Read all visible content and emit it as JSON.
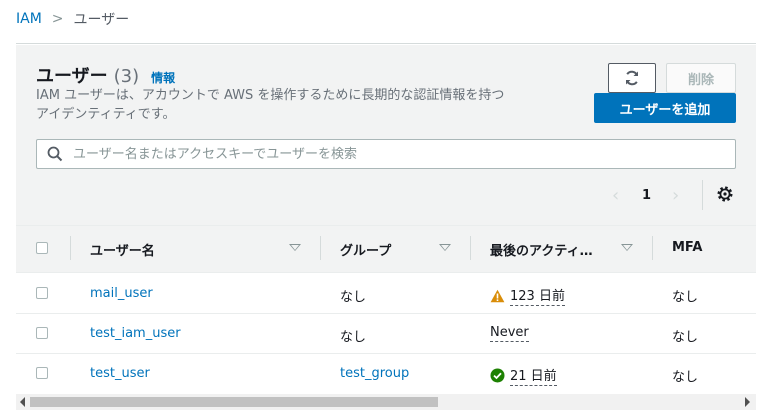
{
  "breadcrumb": {
    "root": "IAM",
    "separator": ">",
    "current": "ユーザー"
  },
  "header": {
    "title": "ユーザー",
    "count": "(3)",
    "info": "情報",
    "description": "IAM ユーザーは、アカウントで AWS を操作するために長期的な認証情報を持つアイデンティティです。",
    "refresh_icon": "refresh-icon",
    "delete_label": "削除",
    "add_label": "ユーザーを追加"
  },
  "search": {
    "placeholder": "ユーザー名またはアクセスキーでユーザーを検索",
    "value": ""
  },
  "pagination": {
    "page": "1",
    "prev": "‹",
    "next": "›"
  },
  "table": {
    "columns": [
      "ユーザー名",
      "グループ",
      "最後のアクティ…",
      "MFA"
    ],
    "rows": [
      {
        "user": "mail_user",
        "group": "なし",
        "activity": "123 日前",
        "activity_status": "warning",
        "mfa": "なし"
      },
      {
        "user": "test_iam_user",
        "group": "なし",
        "activity": "Never",
        "activity_status": "none",
        "mfa": "なし"
      },
      {
        "user": "test_user",
        "group": "test_group",
        "activity": "21 日前",
        "activity_status": "success",
        "mfa": "なし"
      }
    ]
  },
  "colors": {
    "link": "#0073bb",
    "primary_button": "#0073bb",
    "warning": "#d98d09",
    "success": "#1d8102"
  }
}
